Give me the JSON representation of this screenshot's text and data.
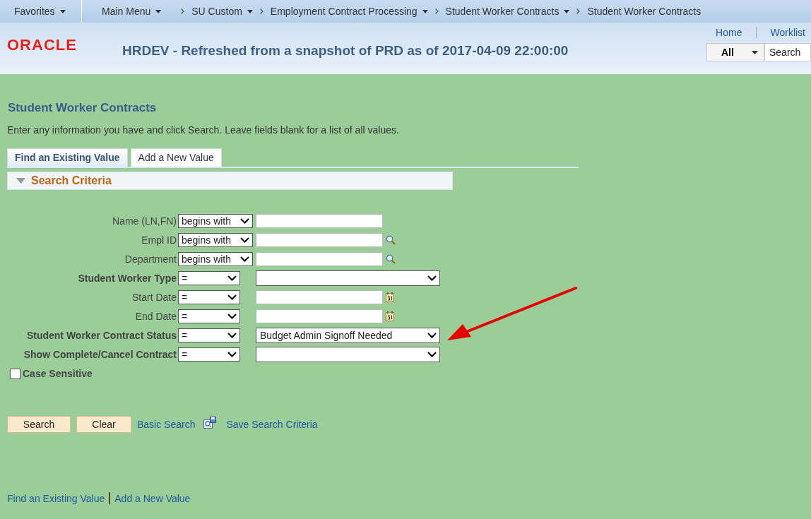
{
  "nav": {
    "items": [
      {
        "label": "Favorites",
        "dropdown": true
      },
      {
        "label": "Main Menu",
        "dropdown": true
      },
      {
        "label": "SU Custom",
        "dropdown": true
      },
      {
        "label": "Employment Contract Processing",
        "dropdown": true
      },
      {
        "label": "Student Worker Contracts",
        "dropdown": true
      },
      {
        "label": "Student Worker Contracts",
        "dropdown": false
      }
    ]
  },
  "header": {
    "logo": "ORACLE",
    "title": "HRDEV - Refreshed from a snapshot of PRD as of 2017-04-09 22:00:00",
    "links": [
      "Home",
      "Worklist"
    ],
    "search_scope": "All",
    "search_placeholder": "Search"
  },
  "page": {
    "title": "Student Worker Contracts",
    "instructions": "Enter any information you have and click Search. Leave fields blank for a list of all values."
  },
  "tabs": [
    {
      "label": "Find an Existing Value",
      "selected": true
    },
    {
      "label": "Add a New Value",
      "selected": false
    }
  ],
  "section": {
    "title": "Search Criteria",
    "expanded": true
  },
  "criteria": [
    {
      "kind": "text",
      "label": "Name (LN,FN)",
      "bold": false,
      "operator": "begins with"
    },
    {
      "kind": "lookup",
      "label": "Empl ID",
      "bold": false,
      "operator": "begins with"
    },
    {
      "kind": "lookup",
      "label": "Department",
      "bold": false,
      "operator": "begins with"
    },
    {
      "kind": "select",
      "label": "Student Worker Type",
      "bold": true,
      "operator": "="
    },
    {
      "kind": "date",
      "label": "Start Date",
      "bold": false,
      "operator": "="
    },
    {
      "kind": "date",
      "label": "End Date",
      "bold": false,
      "operator": "="
    },
    {
      "kind": "select",
      "label": "Student Worker Contract Status",
      "bold": true,
      "operator": "=",
      "value": "Budget Admin Signoff Needed"
    },
    {
      "kind": "select",
      "label": "Show Complete/Cancel Contract",
      "bold": true,
      "operator": "="
    }
  ],
  "case_sensitive": {
    "label": "Case Sensitive",
    "checked": false
  },
  "buttons": [
    "Search",
    "Clear"
  ],
  "links": [
    "Basic Search",
    "Save Search Criteria"
  ],
  "footer_links": [
    "Find an Existing Value",
    "Add a New Value"
  ]
}
